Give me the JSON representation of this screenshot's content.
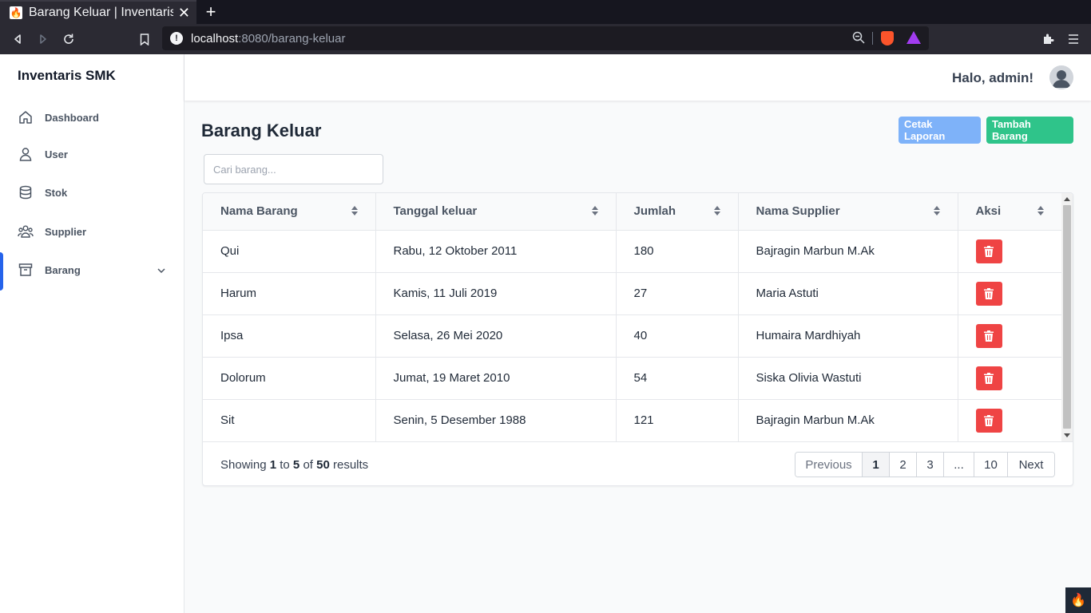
{
  "browser": {
    "tab_title": "Barang Keluar | Inventaris",
    "url_host": "localhost",
    "url_path": ":8080/barang-keluar"
  },
  "app": {
    "brand": "Inventaris SMK",
    "greeting": "Halo, admin!"
  },
  "sidebar": {
    "items": [
      {
        "label": "Dashboard",
        "icon": "home-icon"
      },
      {
        "label": "User",
        "icon": "user-icon"
      },
      {
        "label": "Stok",
        "icon": "database-icon"
      },
      {
        "label": "Supplier",
        "icon": "users-icon"
      },
      {
        "label": "Barang",
        "icon": "archive-icon",
        "active": true
      }
    ]
  },
  "main": {
    "title": "Barang Keluar",
    "print_label": "Cetak Laporan",
    "add_label": "Tambah Barang",
    "search_placeholder": "Cari barang..."
  },
  "table": {
    "headers": [
      "Nama Barang",
      "Tanggal keluar",
      "Jumlah",
      "Nama Supplier",
      "Aksi"
    ],
    "rows": [
      [
        "Qui",
        "Rabu, 12 Oktober 2011",
        "180",
        "Bajragin Marbun M.Ak"
      ],
      [
        "Harum",
        "Kamis, 11 Juli 2019",
        "27",
        "Maria Astuti"
      ],
      [
        "Ipsa",
        "Selasa, 26 Mei 2020",
        "40",
        "Humaira Mardhiyah"
      ],
      [
        "Dolorum",
        "Jumat, 19 Maret 2010",
        "54",
        "Siska Olivia Wastuti"
      ],
      [
        "Sit",
        "Senin, 5 Desember 1988",
        "121",
        "Bajragin Marbun M.Ak"
      ]
    ]
  },
  "pagination": {
    "showing": "Showing",
    "from": "1",
    "to_word": "to",
    "to": "5",
    "of_word": "of",
    "total": "50",
    "results_word": "results",
    "previous": "Previous",
    "pages": [
      "1",
      "2",
      "3",
      "...",
      "10"
    ],
    "current": "1",
    "next": "Next"
  },
  "colors": {
    "accent": "#2563eb",
    "print_button": "#7eb2f9",
    "add_button": "#2fc48a",
    "delete_button": "#ef4444"
  }
}
